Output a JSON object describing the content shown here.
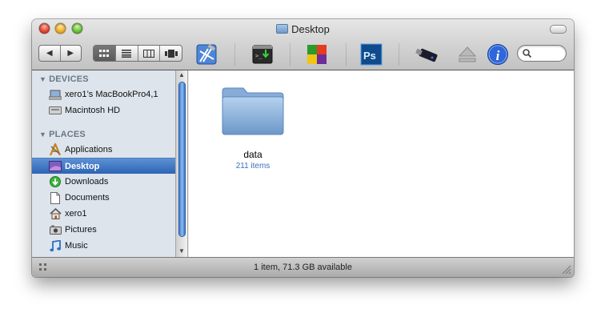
{
  "window": {
    "title": "Desktop"
  },
  "toolbar": {
    "back_symbol": "◀",
    "forward_symbol": "▶",
    "view_icons": [
      "grid-view-icon",
      "list-view-icon",
      "column-view-icon",
      "coverflow-view-icon"
    ],
    "apps": [
      "xcode-icon",
      "terminal-icon",
      "colorful-app-icon",
      "photoshop-icon",
      "usb-drive-icon",
      "eject-icon",
      "info-icon"
    ],
    "photoshop_label": "Ps",
    "info_label": "i"
  },
  "sidebar": {
    "devices_header": "DEVICES",
    "places_header": "PLACES",
    "devices": [
      {
        "label": "xero1’s MacBookPro4,1",
        "icon": "laptop-icon"
      },
      {
        "label": "Macintosh HD",
        "icon": "hard-drive-icon"
      }
    ],
    "places": [
      {
        "label": "Applications",
        "icon": "applications-icon"
      },
      {
        "label": "Desktop",
        "icon": "desktop-icon",
        "selected": true
      },
      {
        "label": "Downloads",
        "icon": "downloads-icon"
      },
      {
        "label": "Documents",
        "icon": "documents-icon"
      },
      {
        "label": "xero1",
        "icon": "home-icon"
      },
      {
        "label": "Pictures",
        "icon": "pictures-icon"
      },
      {
        "label": "Music",
        "icon": "music-icon"
      }
    ]
  },
  "content": {
    "items": [
      {
        "name": "data",
        "subtitle": "211 items",
        "icon": "folder-icon"
      }
    ]
  },
  "status": {
    "text": "1 item, 71.3 GB available"
  },
  "colors": {
    "selection": "#3b73c4",
    "sidebar_bg": "#dde4ec",
    "item_subtitle": "#3a6fc0"
  }
}
